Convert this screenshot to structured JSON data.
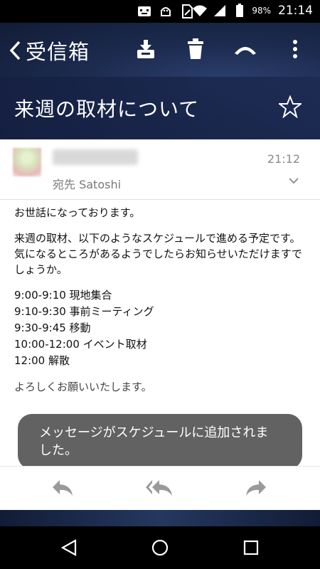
{
  "status_bar": {
    "battery_percent": "98%",
    "time": "21:14",
    "icons": [
      "notification-icon",
      "android-icon",
      "sim-icon",
      "wifi-icon",
      "signal-icon",
      "battery-icon"
    ]
  },
  "toolbar": {
    "back_label": "受信箱",
    "icons": [
      "archive-icon",
      "trash-icon",
      "boomerang-icon",
      "more-vert-icon"
    ]
  },
  "email": {
    "subject": "来週の取材について",
    "recipient": "宛先 Satoshi",
    "time": "21:12",
    "greeting": "お世話になっております。",
    "paragraph1": "来週の取材、以下のようなスケジュールで進める予定です。\n気になるところがあるようでしたらお知らせいただけますでしょうか。",
    "schedule": [
      "9:00-9:10 現地集合",
      "9:10-9:30 事前ミーティング",
      "9:30-9:45 移動",
      "10:00-12:00 イベント取材",
      "12:00 解散"
    ],
    "closing": "よろしくお願いいたします。"
  },
  "toast": {
    "message": "メッセージがスケジュールに追加されました。"
  },
  "actions": [
    "reply-icon",
    "reply-all-icon",
    "forward-icon"
  ],
  "nav": [
    "back-nav-icon",
    "home-nav-icon",
    "recents-nav-icon"
  ],
  "colors": {
    "header_dark": "#1c2b4f",
    "toast_bg": "#5a5a5a",
    "action_icon": "#9a9a9a"
  }
}
